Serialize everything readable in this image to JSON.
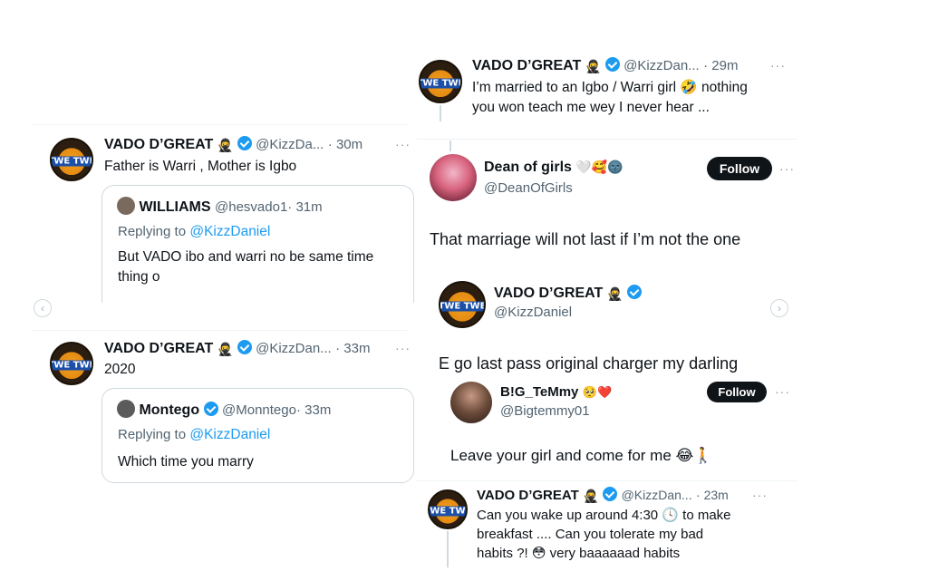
{
  "left": {
    "tweet1": {
      "name": "VADO D’GREAT",
      "handle": "@KizzDa...",
      "time": "· 30m",
      "text": "Father is Warri , Mother is Igbo",
      "quote": {
        "name": "WILLIAMS",
        "handle": "@hesvado1",
        "time": "· 31m",
        "replying_label": "Replying to",
        "replying_to": "@KizzDaniel",
        "text": "But VADO ibo and warri no be same time thing o"
      }
    },
    "tweet2": {
      "name": "VADO D’GREAT",
      "handle": "@KizzDan...",
      "time": "· 33m",
      "text": "2020",
      "quote": {
        "name": "Montego",
        "handle": "@Monntego",
        "time": "· 33m",
        "replying_label": "Replying to",
        "replying_to": "@KizzDaniel",
        "text": "Which time you marry"
      }
    },
    "nav_prev": "‹"
  },
  "right": {
    "tweet_top": {
      "name": "VADO D’GREAT",
      "handle": "@KizzDan...",
      "time": "· 29m",
      "text_line1": "I’m married to an Igbo / Warri girl 🤣 nothing",
      "text_line2": "you won teach me wey I never hear ..."
    },
    "dean": {
      "name": "Dean of girls",
      "emojis": "🤍🥰🌚",
      "handle": "@DeanOfGirls",
      "follow_label": "Follow",
      "text": "That  marriage will not last if I’m not the one"
    },
    "vado_card": {
      "name": "VADO D’GREAT",
      "handle": "@KizzDaniel",
      "text": "E go last pass original charger my darling"
    },
    "temmy": {
      "name": "B!G_TeMmy",
      "emojis": "🥺❤️",
      "handle": "@Bigtemmy01",
      "follow_label": "Follow",
      "text": "Leave your girl and come for me 😂🚶"
    },
    "tweet_bottom": {
      "name": "VADO D’GREAT",
      "handle": "@KizzDan...",
      "time": "· 23m",
      "text_line1": "Can you wake up around 4:30 🕓 to make",
      "text_line2": "breakfast .... Can you tolerate my bad",
      "text_line3": "habits ?! 😳 very baaaaaad habits"
    },
    "nav_next": "›"
  },
  "avatar_logo": "TWE TWE",
  "more_icon": "···",
  "ninja_emoji": "🥷"
}
